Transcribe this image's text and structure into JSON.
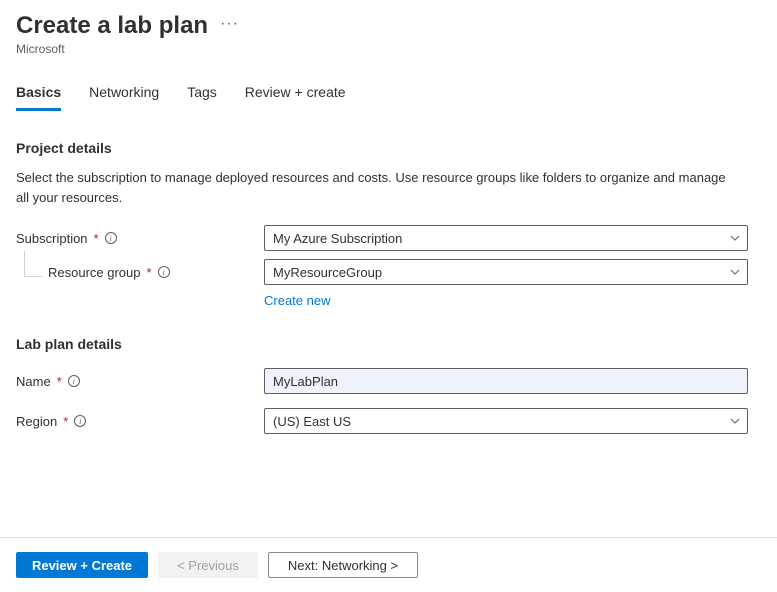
{
  "header": {
    "title": "Create a lab plan",
    "subtitle": "Microsoft"
  },
  "tabs": {
    "basics": "Basics",
    "networking": "Networking",
    "tags": "Tags",
    "review": "Review + create"
  },
  "project": {
    "section_title": "Project details",
    "description": "Select the subscription to manage deployed resources and costs. Use resource groups like folders to organize and manage all your resources.",
    "subscription_label": "Subscription",
    "subscription_value": "My Azure Subscription",
    "resource_group_label": "Resource group",
    "resource_group_value": "MyResourceGroup",
    "create_new_label": "Create new"
  },
  "labplan": {
    "section_title": "Lab plan details",
    "name_label": "Name",
    "name_value": "MyLabPlan",
    "region_label": "Region",
    "region_value": "(US) East US"
  },
  "footer": {
    "review_create": "Review + Create",
    "previous": "< Previous",
    "next": "Next: Networking >"
  }
}
